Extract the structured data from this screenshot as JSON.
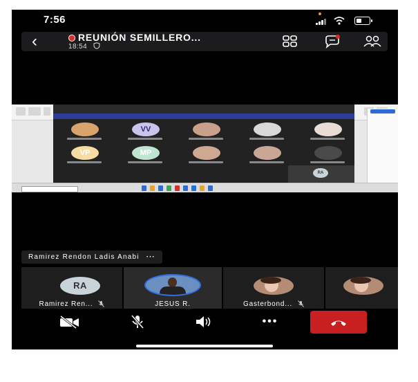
{
  "status_bar": {
    "time": "7:56"
  },
  "meeting": {
    "title": "REUNIÓN SEMILLERO...",
    "elapsed": "18:54"
  },
  "shared_screen": {
    "participants": [
      {
        "initials": "",
        "color": "#d9a46b"
      },
      {
        "initials": "VV",
        "color": "#c8c4ec"
      },
      {
        "initials": "",
        "color": "#c9a18a"
      },
      {
        "initials": "",
        "color": "#d8d8d8"
      },
      {
        "initials": "",
        "color": "#e8dcd4"
      },
      {
        "initials": "VP",
        "color": "#f6dba2"
      },
      {
        "initials": "MP",
        "color": "#bfe4cf"
      },
      {
        "initials": "",
        "color": "#cfa892"
      },
      {
        "initials": "",
        "color": "#caa695"
      },
      {
        "initials": "",
        "color": "#4a4a4a"
      }
    ],
    "self_initials": "RA"
  },
  "active_speaker": {
    "name": "Ramirez Rendon Ladis Anabi",
    "more": "···"
  },
  "participant_strip": [
    {
      "name": "Ramirez Ren...",
      "initials": "RA",
      "muted": true
    },
    {
      "name": "JESUS R.",
      "initials": "",
      "muted": false
    },
    {
      "name": "Gasterbond...",
      "initials": "",
      "muted": true
    }
  ],
  "toolbar": {
    "more": "•••"
  },
  "colors": {
    "leave": "#c82020",
    "active_border": "#2f6fe0",
    "recording": "#e02a2a"
  }
}
